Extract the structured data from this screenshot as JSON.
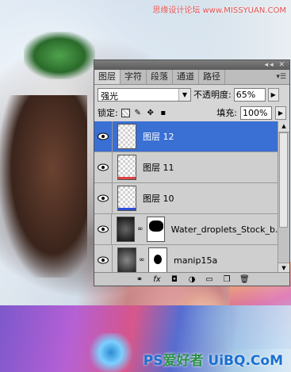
{
  "watermarks": {
    "top": "思缘设计论坛 www.MISSYUAN.COM",
    "bottom_ps": "PS",
    "bottom_text": "爱好者",
    "bottom_url": "UiBQ.CoM"
  },
  "panel": {
    "tabs": [
      "图层",
      "字符",
      "段落",
      "通道",
      "路径"
    ],
    "active_tab": "图层",
    "blend_mode": "强光",
    "opacity_label": "不透明度:",
    "opacity_value": "65%",
    "lock_label": "锁定:",
    "fill_label": "填充:",
    "fill_value": "100%",
    "layers": [
      {
        "name": "图层 12",
        "selected": true
      },
      {
        "name": "图层 11",
        "selected": false
      },
      {
        "name": "图层 10",
        "selected": false
      },
      {
        "name": "Water_droplets_Stock_b...",
        "selected": false
      },
      {
        "name": "manip15a",
        "selected": false
      }
    ]
  },
  "colors": {
    "selection": "#3a6fd4",
    "panel_bg": "#d6d6d6"
  },
  "icons": {
    "bottom_bar": [
      "link-icon",
      "fx-icon",
      "add-mask-icon",
      "adjustment-icon",
      "group-folder-icon",
      "new-layer-icon",
      "trash-icon"
    ]
  }
}
